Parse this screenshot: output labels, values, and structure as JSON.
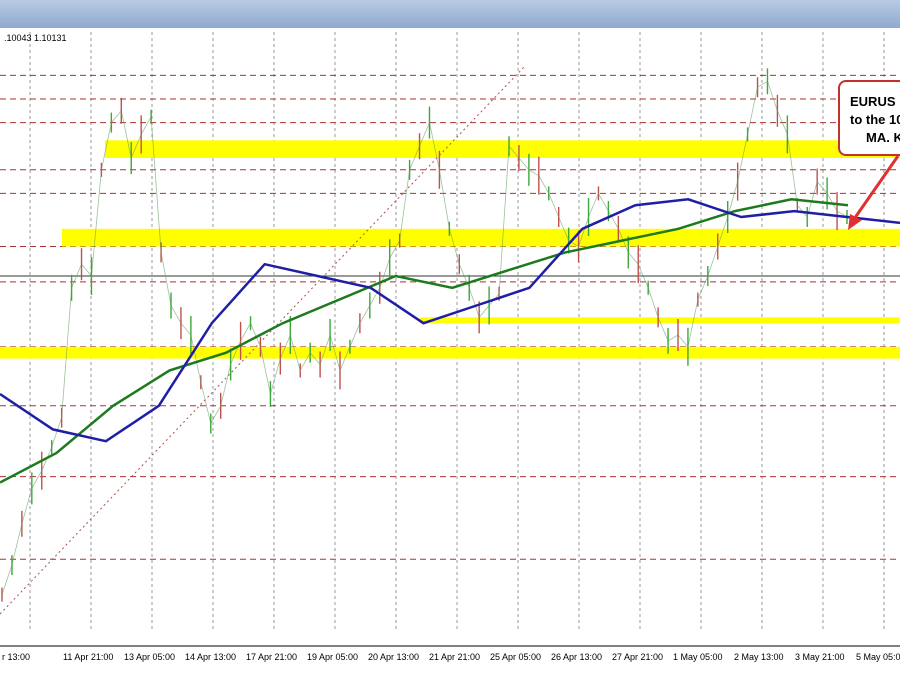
{
  "ohlc_readout": ".10043 1.10131",
  "annotation": {
    "line1": "EURUS",
    "line2": "to the 10",
    "line3": "MA. K"
  },
  "chart_data": {
    "type": "line",
    "title": "",
    "xlabel": "",
    "ylabel": "",
    "x_ticks": [
      "r 13:00",
      "11 Apr 21:00",
      "13 Apr 05:00",
      "14 Apr 13:00",
      "17 Apr 21:00",
      "19 Apr 05:00",
      "20 Apr 13:00",
      "21 Apr 21:00",
      "25 Apr 05:00",
      "26 Apr 13:00",
      "27 Apr 21:00",
      "1 May 05:00",
      "2 May 13:00",
      "3 May 21:00",
      "5 May 05:00"
    ],
    "price_series": {
      "name": "",
      "color": "#3aa83a",
      "values": [
        0.06,
        0.11,
        0.18,
        0.24,
        0.27,
        0.31,
        0.36,
        0.58,
        0.62,
        0.6,
        0.78,
        0.86,
        0.88,
        0.8,
        0.84,
        0.87,
        0.64,
        0.55,
        0.52,
        0.5,
        0.42,
        0.35,
        0.38,
        0.45,
        0.49,
        0.52,
        0.48,
        0.4,
        0.46,
        0.5,
        0.44,
        0.47,
        0.45,
        0.5,
        0.44,
        0.48,
        0.52,
        0.55,
        0.58,
        0.63,
        0.66,
        0.78,
        0.82,
        0.86,
        0.78,
        0.68,
        0.62,
        0.58,
        0.53,
        0.55,
        0.57,
        0.82,
        0.8,
        0.78,
        0.77,
        0.74,
        0.7,
        0.66,
        0.65,
        0.7,
        0.74,
        0.71,
        0.68,
        0.64,
        0.62,
        0.58,
        0.53,
        0.49,
        0.5,
        0.48,
        0.56,
        0.6,
        0.65,
        0.7,
        0.76,
        0.84,
        0.92,
        0.93,
        0.88,
        0.84,
        0.72,
        0.7,
        0.76,
        0.74,
        0.71,
        0.7
      ]
    },
    "ma_blue": {
      "name": "",
      "color": "#1f1fa6",
      "values": [
        0.4,
        0.34,
        0.32,
        0.38,
        0.52,
        0.62,
        0.6,
        0.58,
        0.52,
        0.55,
        0.58,
        0.68,
        0.72,
        0.73,
        0.7,
        0.71,
        0.7,
        0.69
      ]
    },
    "ma_green": {
      "name": "",
      "color": "#1e7a1e",
      "values": [
        0.25,
        0.3,
        0.38,
        0.44,
        0.47,
        0.52,
        0.56,
        0.6,
        0.58,
        0.61,
        0.64,
        0.66,
        0.68,
        0.71,
        0.73,
        0.72
      ]
    },
    "support_resistance_zones": [
      {
        "from": 0.8,
        "to": 0.83
      },
      {
        "from": 0.65,
        "to": 0.68
      },
      {
        "from": 0.52,
        "to": 0.53
      },
      {
        "from": 0.46,
        "to": 0.48
      }
    ],
    "zone_color": "#ffff00",
    "grid": true
  }
}
